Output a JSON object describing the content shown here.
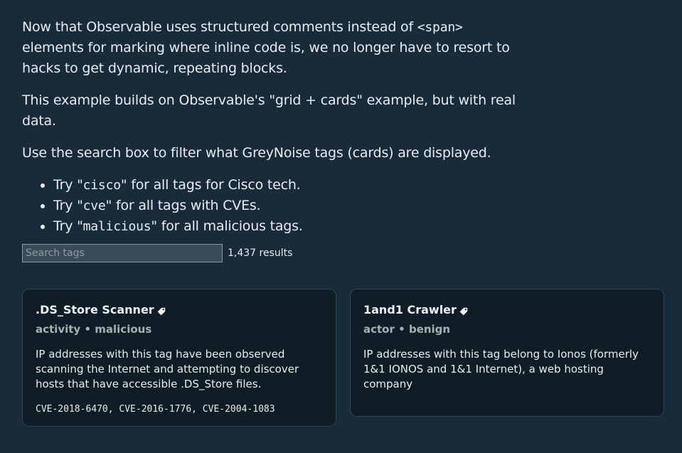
{
  "intro": {
    "p1_a": "Now that Observable uses structured comments instead of ",
    "p1_code": "<span>",
    "p1_b": " elements for marking where inline code is, we no longer have to resort to hacks to get dynamic, repeating blocks.",
    "p2": "This example builds on Observable's \"grid + cards\" example, but with real data.",
    "p3": "Use the search box to filter what GreyNoise tags (cards) are displayed."
  },
  "tips": [
    {
      "prefix": "Try \"",
      "code": "cisco",
      "suffix": "\" for all tags for Cisco tech."
    },
    {
      "prefix": "Try \"",
      "code": "cve",
      "suffix": "\" for all tags with CVEs."
    },
    {
      "prefix": "Try \"",
      "code": "malicious",
      "suffix": "\" for all malicious tags."
    }
  ],
  "search": {
    "placeholder": "Search tags",
    "value": "",
    "results": "1,437 results"
  },
  "cards": [
    {
      "title": ".DS_Store Scanner",
      "icon": "tag-icon",
      "category": "activity",
      "sep": "•",
      "intention": "malicious",
      "description": "IP addresses with this tag have been observed scanning the Internet and attempting to discover hosts that have accessible .DS_Store files.",
      "cves": "CVE-2018-6470, CVE-2016-1776, CVE-2004-1083"
    },
    {
      "title": "1and1 Crawler",
      "icon": "tag-icon",
      "category": "actor",
      "sep": "•",
      "intention": "benign",
      "description": "IP addresses with this tag belong to Ionos (formerly 1&1 IONOS and 1&1 Internet), a web hosting company",
      "cves": ""
    }
  ],
  "colors": {
    "background": "#172b3a",
    "card": "#0f1e26",
    "muted": "#a5b0b7"
  }
}
